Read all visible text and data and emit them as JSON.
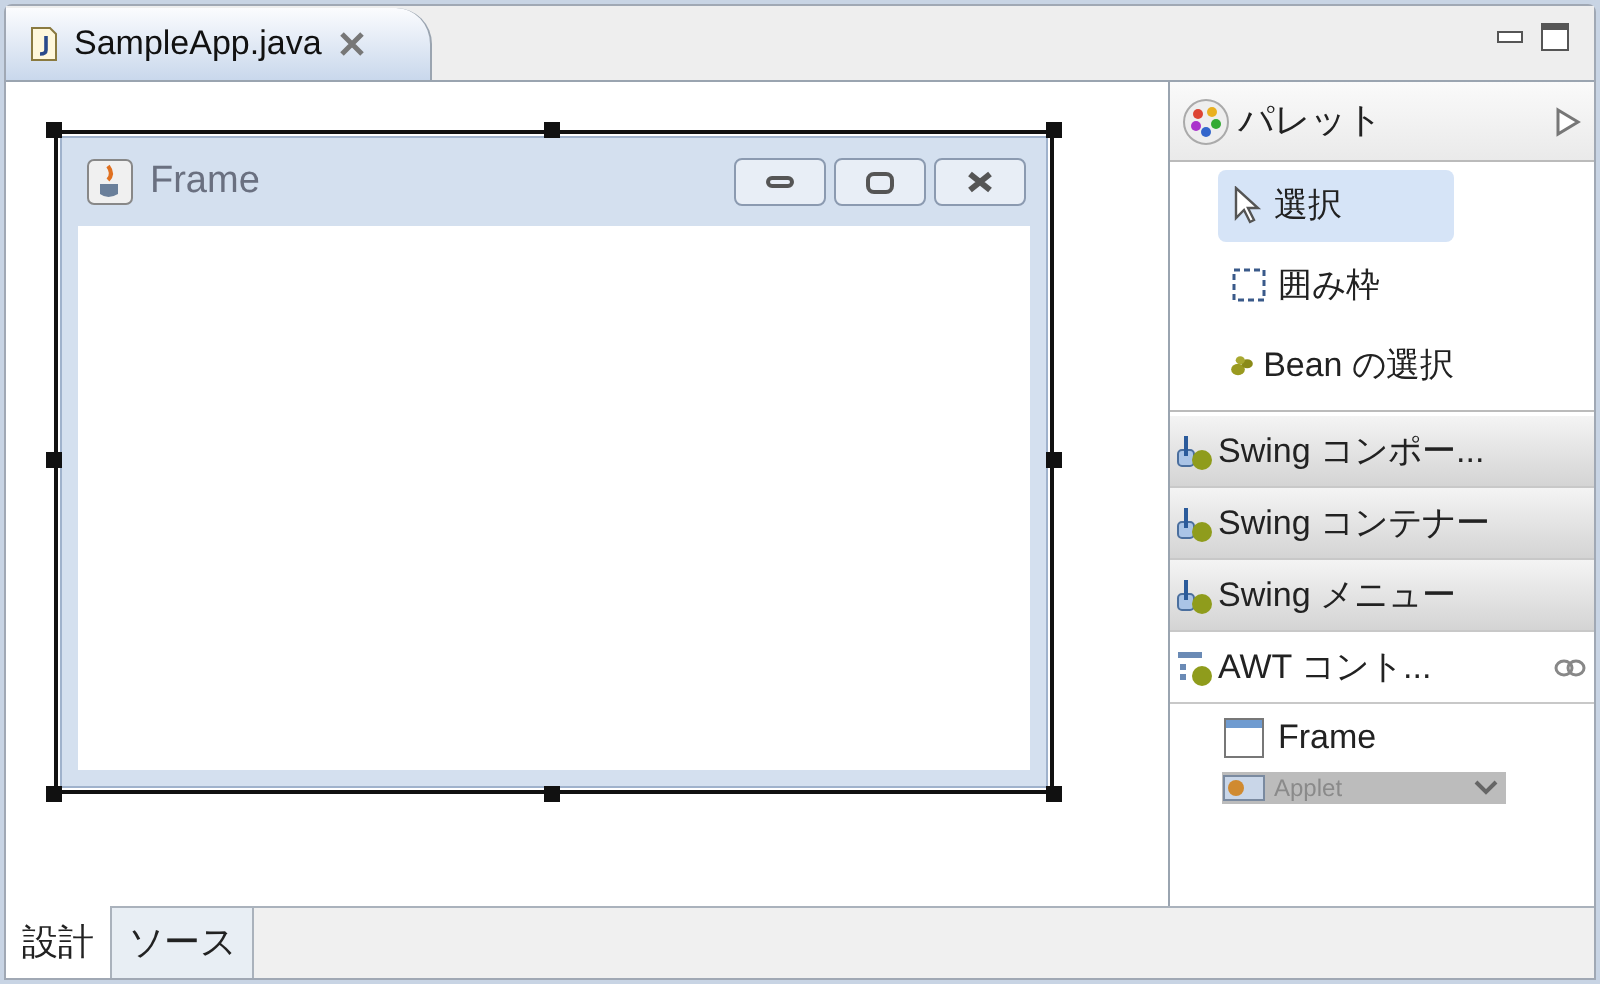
{
  "editor_tab": {
    "title": "SampleApp.java"
  },
  "design_frame": {
    "title": "Frame",
    "selected": true
  },
  "palette": {
    "title": "パレット",
    "tools": [
      {
        "kind": "select",
        "label": "選択",
        "selected": true
      },
      {
        "kind": "marquee",
        "label": "囲み枠",
        "selected": false
      },
      {
        "kind": "bean",
        "label": "Bean の選択",
        "selected": false
      }
    ],
    "drawers": [
      {
        "kind": "swing",
        "label": "Swing コンポー...",
        "expanded": false
      },
      {
        "kind": "swing",
        "label": "Swing コンテナー",
        "expanded": false
      },
      {
        "kind": "swing",
        "label": "Swing メニュー",
        "expanded": false
      },
      {
        "kind": "awt",
        "label": "AWT コント...",
        "expanded": true,
        "items": [
          {
            "kind": "frame",
            "label": "Frame"
          },
          {
            "kind": "applet",
            "label": "Applet"
          }
        ]
      }
    ]
  },
  "bottom_tabs": [
    {
      "label": "設計",
      "selected": true
    },
    {
      "label": "ソース",
      "selected": false
    }
  ]
}
